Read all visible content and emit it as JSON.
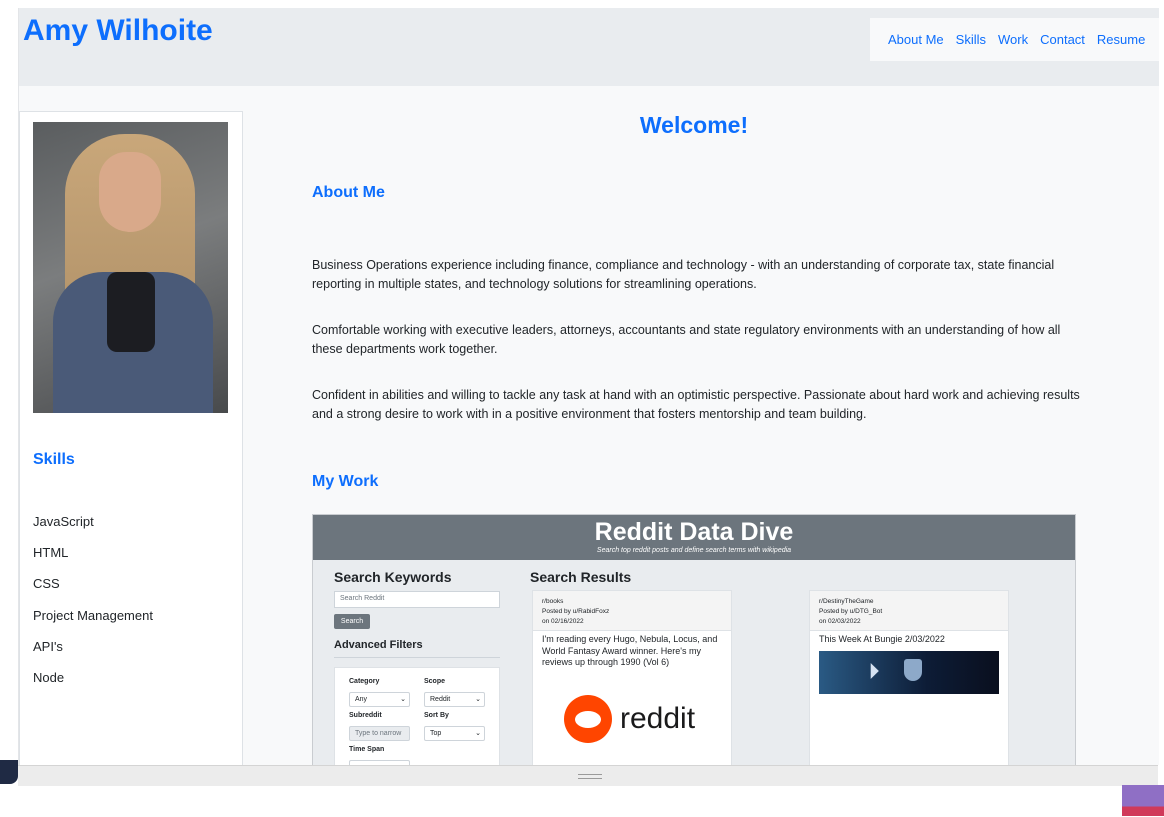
{
  "header": {
    "title": "Amy Wilhoite",
    "nav": [
      "About Me",
      "Skills",
      "Work",
      "Contact",
      "Resume"
    ]
  },
  "sidebar": {
    "skills_heading": "Skills",
    "skills": [
      "JavaScript",
      "HTML",
      "CSS",
      "Project Management",
      "API's",
      "Node"
    ]
  },
  "main": {
    "welcome": "Welcome!",
    "about_heading": "About Me",
    "paragraphs": [
      "Business Operations experience including finance, compliance and technology - with an understanding of corporate tax, state financial reporting in multiple states, and technology solutions for streamlining operations.",
      "Comfortable working with executive leaders, attorneys, accountants and state regulatory environments with an understanding of how all these departments work together.",
      "Confident in abilities and willing to tackle any task at hand with an optimistic perspective. Passionate about hard work and achieving results and a strong desire to work with in a positive environment that fosters mentorship and team building."
    ],
    "work_heading": "My Work"
  },
  "project": {
    "title": "Reddit Data Dive",
    "subtitle": "Search top reddit posts and define search terms with wikipedia",
    "search_heading": "Search Keywords",
    "search_placeholder": "Search Reddit",
    "search_button": "Search",
    "advanced_heading": "Advanced Filters",
    "filters": {
      "category_label": "Category",
      "category_value": "Any",
      "scope_label": "Scope",
      "scope_value": "Reddit",
      "subreddit_label": "Subreddit",
      "subreddit_placeholder": "Type to narrow",
      "sort_label": "Sort By",
      "sort_value": "Top",
      "timespan_label": "Time Span"
    },
    "results_heading": "Search Results",
    "results": [
      {
        "subreddit": "r/books",
        "posted_by": "Posted by u/RabidFoxz",
        "date": "on 02/16/2022",
        "title": "I'm reading every Hugo, Nebula, Locus, and World Fantasy Award winner. Here's my reviews up through 1990 (Vol 6)",
        "logo_text": "reddit"
      },
      {
        "subreddit": "r/DestinyTheGame",
        "posted_by": "Posted by u/DTG_Bot",
        "date": "on 02/03/2022",
        "title": "This Week At Bungie 2/03/2022"
      }
    ]
  },
  "colors": {
    "accent": "#0d6efd",
    "header_bg": "#e9ecef",
    "page_bg": "#f8f9fa",
    "banner_bg": "#6c757d",
    "reddit_orange": "#ff4500"
  }
}
